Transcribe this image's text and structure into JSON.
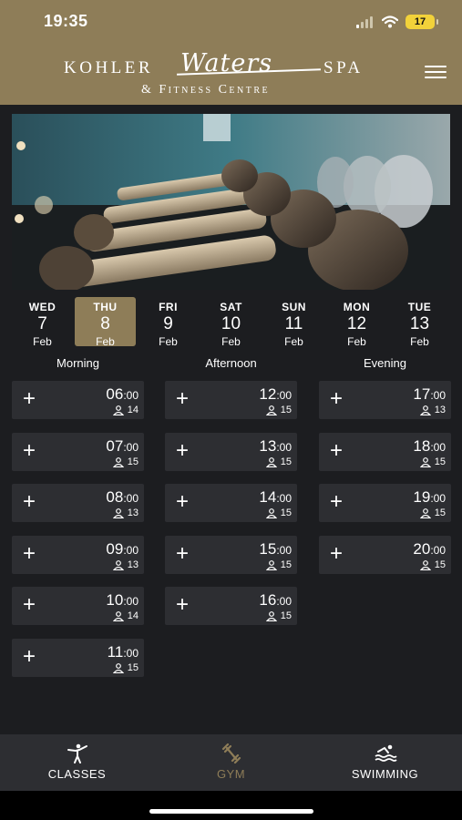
{
  "status_bar": {
    "time": "19:35",
    "battery": "17"
  },
  "brand": {
    "line1_left": "KOHLER",
    "line1_script": "Waters",
    "line1_right": "SPA",
    "line2": "& Fitness Centre"
  },
  "dates": [
    {
      "dow": "WED",
      "day": "7",
      "month": "Feb",
      "selected": false
    },
    {
      "dow": "THU",
      "day": "8",
      "month": "Feb",
      "selected": true
    },
    {
      "dow": "FRI",
      "day": "9",
      "month": "Feb",
      "selected": false
    },
    {
      "dow": "SAT",
      "day": "10",
      "month": "Feb",
      "selected": false
    },
    {
      "dow": "SUN",
      "day": "11",
      "month": "Feb",
      "selected": false
    },
    {
      "dow": "MON",
      "day": "12",
      "month": "Feb",
      "selected": false
    },
    {
      "dow": "TUE",
      "day": "13",
      "month": "Feb",
      "selected": false
    }
  ],
  "columns": [
    {
      "title": "Morning",
      "slots": [
        {
          "hour": "06",
          "min": ":00",
          "capacity": "14"
        },
        {
          "hour": "07",
          "min": ":00",
          "capacity": "15"
        },
        {
          "hour": "08",
          "min": ":00",
          "capacity": "13"
        },
        {
          "hour": "09",
          "min": ":00",
          "capacity": "13"
        },
        {
          "hour": "10",
          "min": ":00",
          "capacity": "14"
        },
        {
          "hour": "11",
          "min": ":00",
          "capacity": "15"
        }
      ]
    },
    {
      "title": "Afternoon",
      "slots": [
        {
          "hour": "12",
          "min": ":00",
          "capacity": "15"
        },
        {
          "hour": "13",
          "min": ":00",
          "capacity": "15"
        },
        {
          "hour": "14",
          "min": ":00",
          "capacity": "15"
        },
        {
          "hour": "15",
          "min": ":00",
          "capacity": "15"
        },
        {
          "hour": "16",
          "min": ":00",
          "capacity": "15"
        }
      ]
    },
    {
      "title": "Evening",
      "slots": [
        {
          "hour": "17",
          "min": ":00",
          "capacity": "13"
        },
        {
          "hour": "18",
          "min": ":00",
          "capacity": "15"
        },
        {
          "hour": "19",
          "min": ":00",
          "capacity": "15"
        },
        {
          "hour": "20",
          "min": ":00",
          "capacity": "15"
        }
      ]
    }
  ],
  "slot_plus_symbol": "+",
  "nav": [
    {
      "label": "CLASSES",
      "icon": "martial-arts-icon",
      "active": false
    },
    {
      "label": "GYM",
      "icon": "dumbbell-icon",
      "active": true
    },
    {
      "label": "SWIMMING",
      "icon": "swimmer-icon",
      "active": false
    }
  ],
  "colors": {
    "brand_gold": "#8e7d58",
    "background": "#1c1d20",
    "slot_bg": "#2d2e32"
  }
}
